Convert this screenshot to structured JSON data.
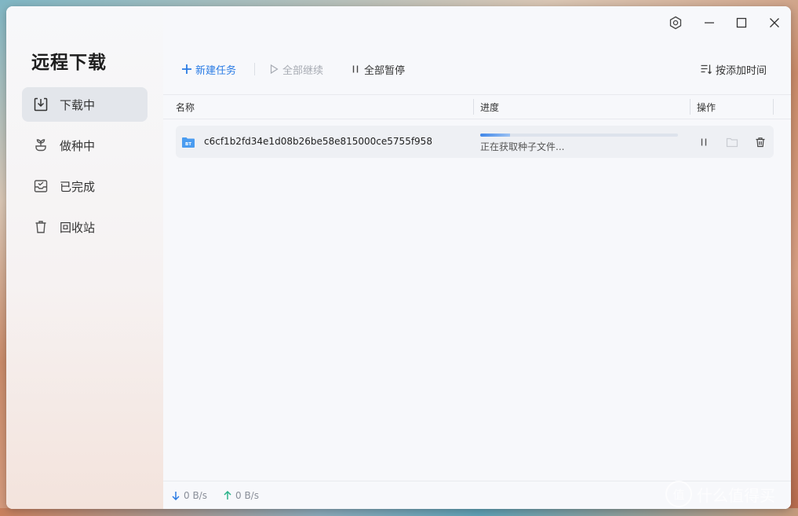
{
  "app": {
    "title": "远程下载"
  },
  "sidebar": {
    "items": [
      {
        "label": "下载中",
        "icon": "download-icon",
        "active": true
      },
      {
        "label": "做种中",
        "icon": "sprout-icon",
        "active": false
      },
      {
        "label": "已完成",
        "icon": "inbox-check-icon",
        "active": false
      },
      {
        "label": "回收站",
        "icon": "trash-icon",
        "active": false
      }
    ]
  },
  "window_controls": [
    "settings-icon",
    "minimize-icon",
    "maximize-icon",
    "close-icon"
  ],
  "toolbar": {
    "new_task": "新建任务",
    "resume_all": "全部继续",
    "pause_all": "全部暂停",
    "sort": "按添加时间"
  },
  "table": {
    "columns": [
      "名称",
      "进度",
      "操作"
    ],
    "rows": [
      {
        "name": "c6cf1b2fd34e1d08b26be58e815000ce5755f958",
        "file_badge": "BT",
        "progress": 0.15,
        "status": "正在获取种子文件..."
      }
    ]
  },
  "status_bar": {
    "download_speed": "0 B/s",
    "upload_speed": "0 B/s"
  },
  "watermark": {
    "badge": "值",
    "text": "什么值得买"
  },
  "colors": {
    "accent": "#2a7be4",
    "disabled": "#a7abb3",
    "progress": "#3f86e8"
  }
}
